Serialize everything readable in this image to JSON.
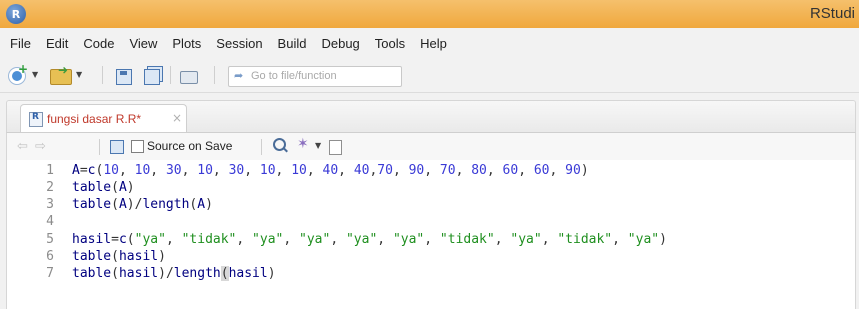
{
  "window": {
    "app_icon_letter": "R",
    "title": "RStudi"
  },
  "menu": [
    "File",
    "Edit",
    "Code",
    "View",
    "Plots",
    "Session",
    "Build",
    "Debug",
    "Tools",
    "Help"
  ],
  "toolbar": {
    "goto_placeholder": "Go to file/function"
  },
  "source_pane": {
    "tab_name": "fungsi dasar R.R*",
    "tab_close": "×",
    "source_on_save_label": "Source on Save",
    "source_on_save_checked": false
  },
  "code_lines": [
    {
      "n": "1",
      "text": "A=c(10, 10, 30, 10, 30, 10, 10, 40, 40,70, 90, 70, 80, 60, 60, 90)"
    },
    {
      "n": "2",
      "text": "table(A)"
    },
    {
      "n": "3",
      "text": "table(A)/length(A)"
    },
    {
      "n": "4",
      "text": ""
    },
    {
      "n": "5",
      "text": "hasil=c(\"ya\", \"tidak\", \"ya\", \"ya\", \"ya\", \"ya\", \"tidak\", \"ya\", \"tidak\", \"ya\")"
    },
    {
      "n": "6",
      "text": "table(hasil)"
    },
    {
      "n": "7",
      "text": "table(hasil)/length(hasil)"
    }
  ],
  "colors": {
    "titlebar": "#f0a83d",
    "code_identifier": "#000080",
    "code_number": "#3a3ad6",
    "code_string": "#1f8f1f",
    "tab_name": "#c0392b"
  }
}
